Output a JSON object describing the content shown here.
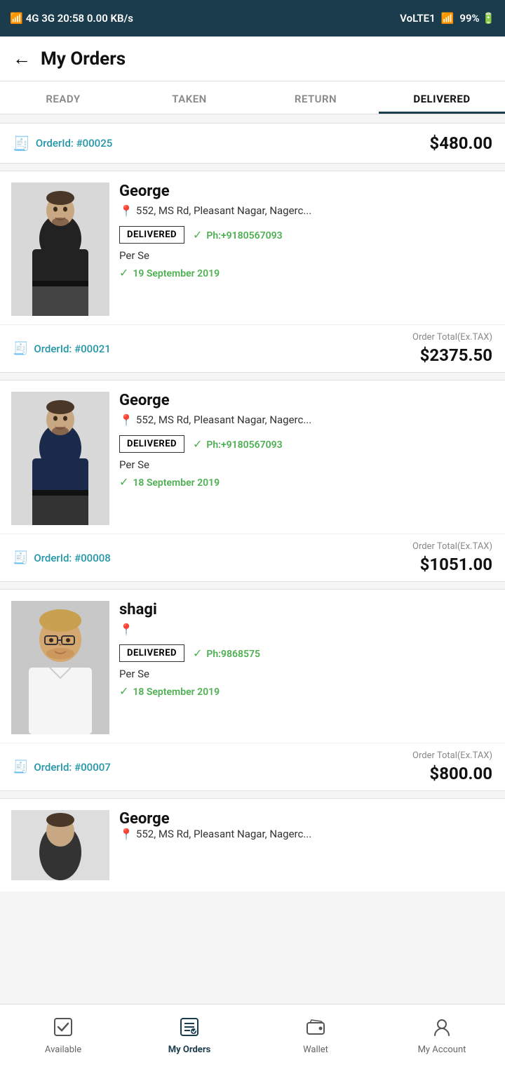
{
  "statusBar": {
    "leftText": "4G 3G 20:58 0.00 KB/s",
    "rightText": "VoLTE1 99%"
  },
  "header": {
    "backArrow": "←",
    "title": "My Orders"
  },
  "tabs": [
    {
      "id": "ready",
      "label": "READY",
      "active": false
    },
    {
      "id": "taken",
      "label": "TAKEN",
      "active": false
    },
    {
      "id": "return",
      "label": "RETURN",
      "active": false
    },
    {
      "id": "delivered",
      "label": "DELIVERED",
      "active": true
    }
  ],
  "topOrderCard": {
    "orderId": "OrderId: #00025",
    "total": "$480.00"
  },
  "orders": [
    {
      "id": "order-1",
      "customer": "George",
      "address": "552, MS Rd, Pleasant Nagar, Nagerc...",
      "phone": "Ph:+9180567093",
      "date": "19 September 2019",
      "perSe": "Per Se",
      "status": "DELIVERED",
      "orderId": "OrderId: #00021",
      "orderTotalLabel": "Order Total(Ex.TAX)",
      "orderTotal": "$2375.50"
    },
    {
      "id": "order-2",
      "customer": "George",
      "address": "552, MS Rd, Pleasant Nagar, Nagerc...",
      "phone": "Ph:+9180567093",
      "date": "18 September 2019",
      "perSe": "Per Se",
      "status": "DELIVERED",
      "orderId": "OrderId: #00008",
      "orderTotalLabel": "Order Total(Ex.TAX)",
      "orderTotal": "$1051.00"
    },
    {
      "id": "order-3",
      "customer": "shagi",
      "address": "",
      "phone": "Ph:9868575",
      "date": "18 September 2019",
      "perSe": "Per Se",
      "status": "DELIVERED",
      "orderId": "OrderId: #00007",
      "orderTotalLabel": "Order Total(Ex.TAX)",
      "orderTotal": "$800.00"
    }
  ],
  "partialOrder": {
    "customer": "George",
    "address": "552, MS Rd, Pleasant Nagar, Nagerc..."
  },
  "bottomNav": [
    {
      "id": "available",
      "label": "Available",
      "icon": "✓",
      "active": false
    },
    {
      "id": "my-orders",
      "label": "My Orders",
      "icon": "📋",
      "active": true
    },
    {
      "id": "wallet",
      "label": "Wallet",
      "icon": "👛",
      "active": false
    },
    {
      "id": "my-account",
      "label": "My Account",
      "icon": "👤",
      "active": false
    }
  ]
}
